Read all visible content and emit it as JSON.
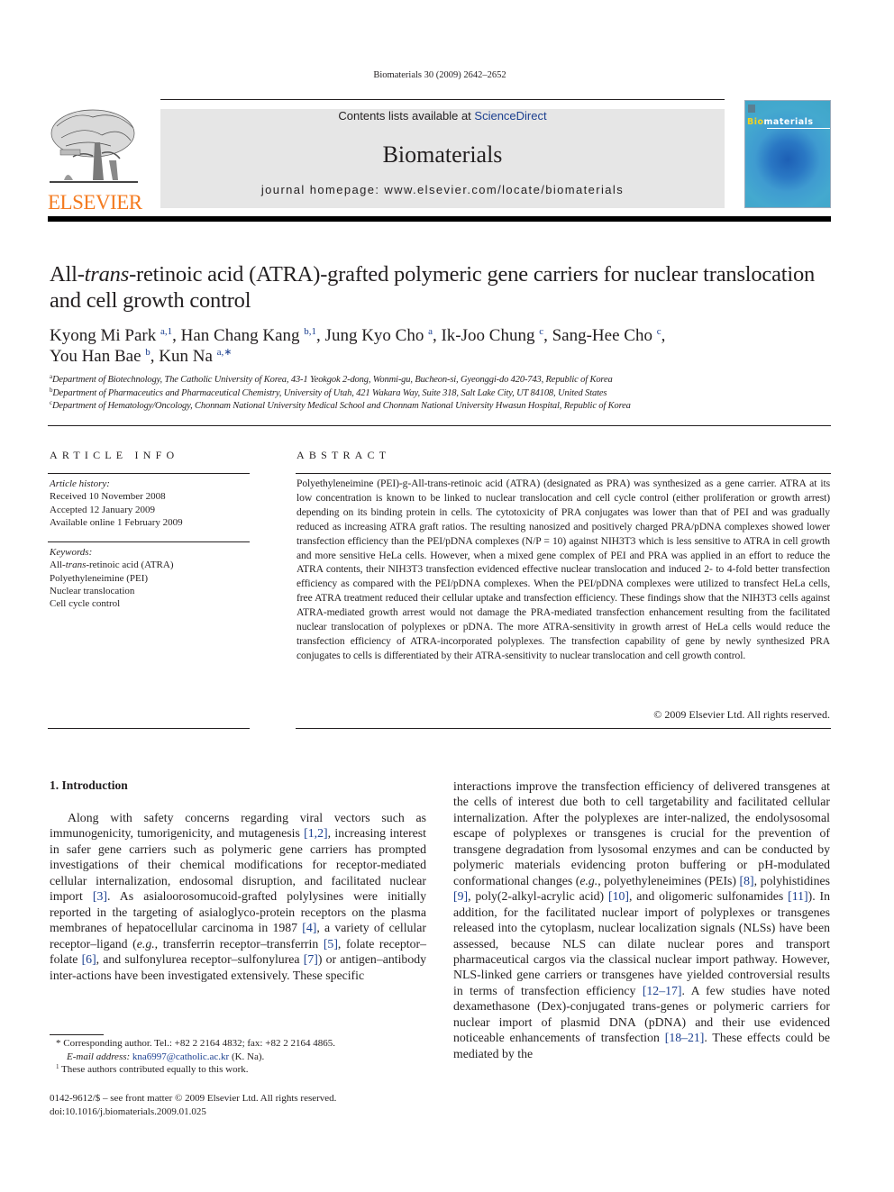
{
  "header": {
    "citation": "Biomaterials 30 (2009) 2642–2652",
    "contents_prefix": "Contents lists available at ",
    "contents_link": "ScienceDirect",
    "journal_name": "Biomaterials",
    "homepage": "journal homepage: www.elsevier.com/locate/biomaterials",
    "publisher_logo_text": "ELSEVIER",
    "cover_title_highlight": "Bio",
    "cover_title_rest": "materials",
    "colors": {
      "publisher_orange": "#f47b20",
      "link_blue": "#1b3f8f",
      "masthead_gray": "#e6e6e6"
    }
  },
  "article": {
    "title_part1": "All-",
    "title_italic": "trans",
    "title_part2": "-retinoic acid (ATRA)-grafted polymeric gene carriers for nuclear translocation and cell growth control",
    "authors": [
      {
        "name": "Kyong Mi Park",
        "sup": "a,1",
        "sep": ", "
      },
      {
        "name": "Han Chang Kang",
        "sup": "b,1",
        "sep": ", "
      },
      {
        "name": "Jung Kyo Cho",
        "sup": "a",
        "sep": ", "
      },
      {
        "name": "Ik-Joo Chung",
        "sup": "c",
        "sep": ", "
      },
      {
        "name": "Sang-Hee Cho",
        "sup": "c",
        "sep": ","
      },
      {
        "name": "You Han Bae",
        "sup": "b",
        "sep": ", "
      },
      {
        "name": "Kun Na",
        "sup": "a,∗",
        "sep": ""
      }
    ],
    "affiliations": [
      {
        "key": "a",
        "text": "Department of Biotechnology, The Catholic University of Korea, 43-1 Yeokgok 2-dong, Wonmi-gu, Bucheon-si, Gyeonggi-do 420-743, Republic of Korea"
      },
      {
        "key": "b",
        "text": "Department of Pharmaceutics and Pharmaceutical Chemistry, University of Utah, 421 Wakara Way, Suite 318, Salt Lake City, UT 84108, United States"
      },
      {
        "key": "c",
        "text": "Department of Hematology/Oncology, Chonnam National University Medical School and Chonnam National University Hwasun Hospital, Republic of Korea"
      }
    ]
  },
  "article_info": {
    "heading": "ARTICLE INFO",
    "history_label": "Article history:",
    "history": [
      "Received 10 November 2008",
      "Accepted 12 January 2009",
      "Available online 1 February 2009"
    ],
    "keywords_label": "Keywords:",
    "keyword1_prefix": "All-",
    "keyword1_italic": "trans",
    "keyword1_suffix": "-retinoic acid (ATRA)",
    "keywords_rest": [
      "Polyethyleneimine (PEI)",
      "Nuclear translocation",
      "Cell cycle control"
    ]
  },
  "abstract": {
    "heading": "ABSTRACT",
    "text": "Polyethyleneimine (PEI)-g-All-trans-retinoic acid (ATRA) (designated as PRA) was synthesized as a gene carrier. ATRA at its low concentration is known to be linked to nuclear translocation and cell cycle control (either proliferation or growth arrest) depending on its binding protein in cells. The cytotoxicity of PRA conjugates was lower than that of PEI and was gradually reduced as increasing ATRA graft ratios. The resulting nanosized and positively charged PRA/pDNA complexes showed lower transfection efficiency than the PEI/pDNA complexes (N/P = 10) against NIH3T3 which is less sensitive to ATRA in cell growth and more sensitive HeLa cells. However, when a mixed gene complex of PEI and PRA was applied in an effort to reduce the ATRA contents, their NIH3T3 transfection evidenced effective nuclear translocation and induced 2- to 4-fold better transfection efficiency as compared with the PEI/pDNA complexes. When the PEI/pDNA complexes were utilized to transfect HeLa cells, free ATRA treatment reduced their cellular uptake and transfection efficiency. These findings show that the NIH3T3 cells against ATRA-mediated growth arrest would not damage the PRA-mediated transfection enhancement resulting from the facilitated nuclear translocation of polyplexes or pDNA. The more ATRA-sensitivity in growth arrest of HeLa cells would reduce the transfection efficiency of ATRA-incorporated polyplexes. The transfection capability of gene by newly synthesized PRA conjugates to cells is differentiated by their ATRA-sensitivity to nuclear translocation and cell growth control.",
    "copyright": "© 2009 Elsevier Ltd. All rights reserved."
  },
  "introduction": {
    "heading": "1.  Introduction",
    "left": [
      {
        "t": "Along with safety concerns regarding viral vectors such as immunogenicity, tumorigenicity, and mutagenesis "
      },
      {
        "ref": "[1,2]"
      },
      {
        "t": ", increasing interest in safer gene carriers such as polymeric gene carriers has prompted investigations of their chemical modifications for receptor-mediated cellular internalization, endosomal disruption, and facilitated nuclear import "
      },
      {
        "ref": "[3]"
      },
      {
        "t": ". As asialoorosomucoid-grafted polylysines were initially reported in the targeting of asialoglyco-protein receptors on the plasma membranes of hepatocellular carcinoma in 1987 "
      },
      {
        "ref": "[4]"
      },
      {
        "t": ", a variety of cellular receptor–ligand ("
      },
      {
        "it": "e.g."
      },
      {
        "t": ", transferrin receptor–transferrin "
      },
      {
        "ref": "[5]"
      },
      {
        "t": ", folate receptor–folate "
      },
      {
        "ref": "[6]"
      },
      {
        "t": ", and sulfonylurea receptor–sulfonylurea "
      },
      {
        "ref": "[7]"
      },
      {
        "t": ") or antigen–antibody inter-actions have been investigated extensively. These specific"
      }
    ],
    "right": [
      {
        "t": "interactions improve the transfection efficiency of delivered transgenes at the cells of interest due both to cell targetability and facilitated cellular internalization. After the polyplexes are inter-nalized, the endolysosomal escape of polyplexes or transgenes is crucial for the prevention of transgene degradation from lysosomal enzymes and can be conducted by polymeric materials evidencing proton buffering or pH-modulated conformational changes ("
      },
      {
        "it": "e.g."
      },
      {
        "t": ", polyethyleneimines (PEIs) "
      },
      {
        "ref": "[8]"
      },
      {
        "t": ", polyhistidines "
      },
      {
        "ref": "[9]"
      },
      {
        "t": ", poly(2-alkyl-acrylic acid) "
      },
      {
        "ref": "[10]"
      },
      {
        "t": ", and oligomeric sulfonamides "
      },
      {
        "ref": "[11]"
      },
      {
        "t": "). In addition, for the facilitated nuclear import of polyplexes or transgenes released into the cytoplasm, nuclear localization signals (NLSs) have been assessed, because NLS can dilate nuclear pores and transport pharmaceutical cargos via the classical nuclear import pathway. However, NLS-linked gene carriers or transgenes have yielded controversial results in terms of transfection efficiency "
      },
      {
        "ref": "[12–17]"
      },
      {
        "t": ". A few studies have noted dexamethasone (Dex)-conjugated trans-genes or polymeric carriers for nuclear import of plasmid DNA (pDNA) and their use evidenced noticeable enhancements of transfection "
      },
      {
        "ref": "[18–21]"
      },
      {
        "t": ". These effects could be mediated by the"
      }
    ]
  },
  "footnotes": {
    "corresponding_mark": "*",
    "corresponding": " Corresponding author. Tel.: +82 2 2164 4832; fax: +82 2 2164 4865.",
    "email_label": "E-mail address:",
    "email": "kna6997@catholic.ac.kr",
    "email_suffix": " (K. Na).",
    "equal_mark": "1",
    "equal": " These authors contributed equally to this work."
  },
  "bottom": {
    "issn": "0142-9612/$ – see front matter © 2009 Elsevier Ltd. All rights reserved.",
    "doi": "doi:10.1016/j.biomaterials.2009.01.025"
  }
}
